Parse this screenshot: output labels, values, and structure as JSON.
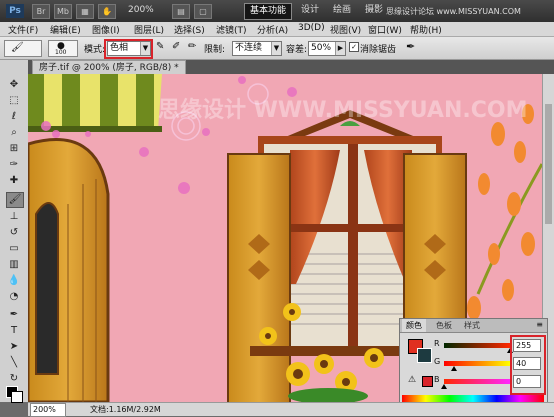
{
  "titlebar": {
    "logo": "Ps",
    "zoom": "200%",
    "workspaces": [
      "基本功能",
      "设计",
      "绘画",
      "摄影"
    ],
    "watermark": "思缘设计论坛 www.MISSYUAN.COM"
  },
  "menu": [
    "文件(F)",
    "编辑(E)",
    "图像(I)",
    "图层(L)",
    "选择(S)",
    "滤镜(T)",
    "分析(A)",
    "3D(D)",
    "视图(V)",
    "窗口(W)",
    "帮助(H)"
  ],
  "options": {
    "brush_size": "100",
    "mode_label": "模式:",
    "mode_value": "色相",
    "limit_label": "限制:",
    "limit_value": "不连续",
    "tolerance_label": "容差:",
    "tolerance_value": "50%",
    "antialias_label": "消除锯齿"
  },
  "document": {
    "tab_title": "房子.tif @ 200% (房子, RGB/8) *",
    "canvas_watermark": "思缘设计 WWW.MISSYUAN.COM"
  },
  "status": {
    "zoom": "200%",
    "doc_info": "文档:1.16M/2.92M"
  },
  "color_panel": {
    "tabs": [
      "颜色",
      "色板",
      "样式"
    ],
    "channels": [
      {
        "label": "R",
        "value": "255",
        "level": 1.0
      },
      {
        "label": "G",
        "value": "40",
        "level": 0.157
      },
      {
        "label": "B",
        "value": "0",
        "level": 0.0
      }
    ],
    "fg_color": "#e03020",
    "bg_color": "#1d3a40"
  },
  "colors": {
    "accent_red": "#d8232a",
    "canvas_pink": "#f1a7b4"
  }
}
